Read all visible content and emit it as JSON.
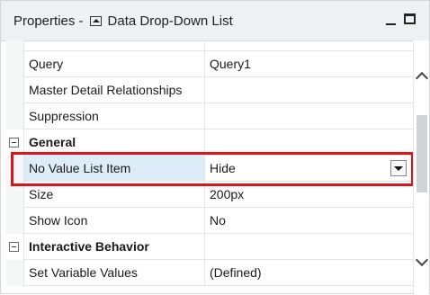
{
  "panel": {
    "title_prefix": "Properties -",
    "title_icon": "dropdown-list-icon",
    "title_name": "Data Drop-Down List"
  },
  "rows": [
    {
      "type": "property",
      "name": "Query",
      "value": "Query1"
    },
    {
      "type": "property",
      "name": "Master Detail Relationships",
      "value": ""
    },
    {
      "type": "property",
      "name": "Suppression",
      "value": ""
    },
    {
      "type": "section",
      "name": "General",
      "collapsed": false
    },
    {
      "type": "property",
      "name": "No Value List Item",
      "value": "Hide",
      "selected": true,
      "has_dropdown": true
    },
    {
      "type": "property",
      "name": "Size",
      "value": "200px"
    },
    {
      "type": "property",
      "name": "Show Icon",
      "value": "No"
    },
    {
      "type": "section",
      "name": "Interactive Behavior",
      "collapsed": false
    },
    {
      "type": "property",
      "name": "Set Variable Values",
      "value": "(Defined)"
    }
  ],
  "colors": {
    "highlight": "#e0131b",
    "selected_row": "#dcecf8",
    "titlebar": "#eef1f3"
  }
}
